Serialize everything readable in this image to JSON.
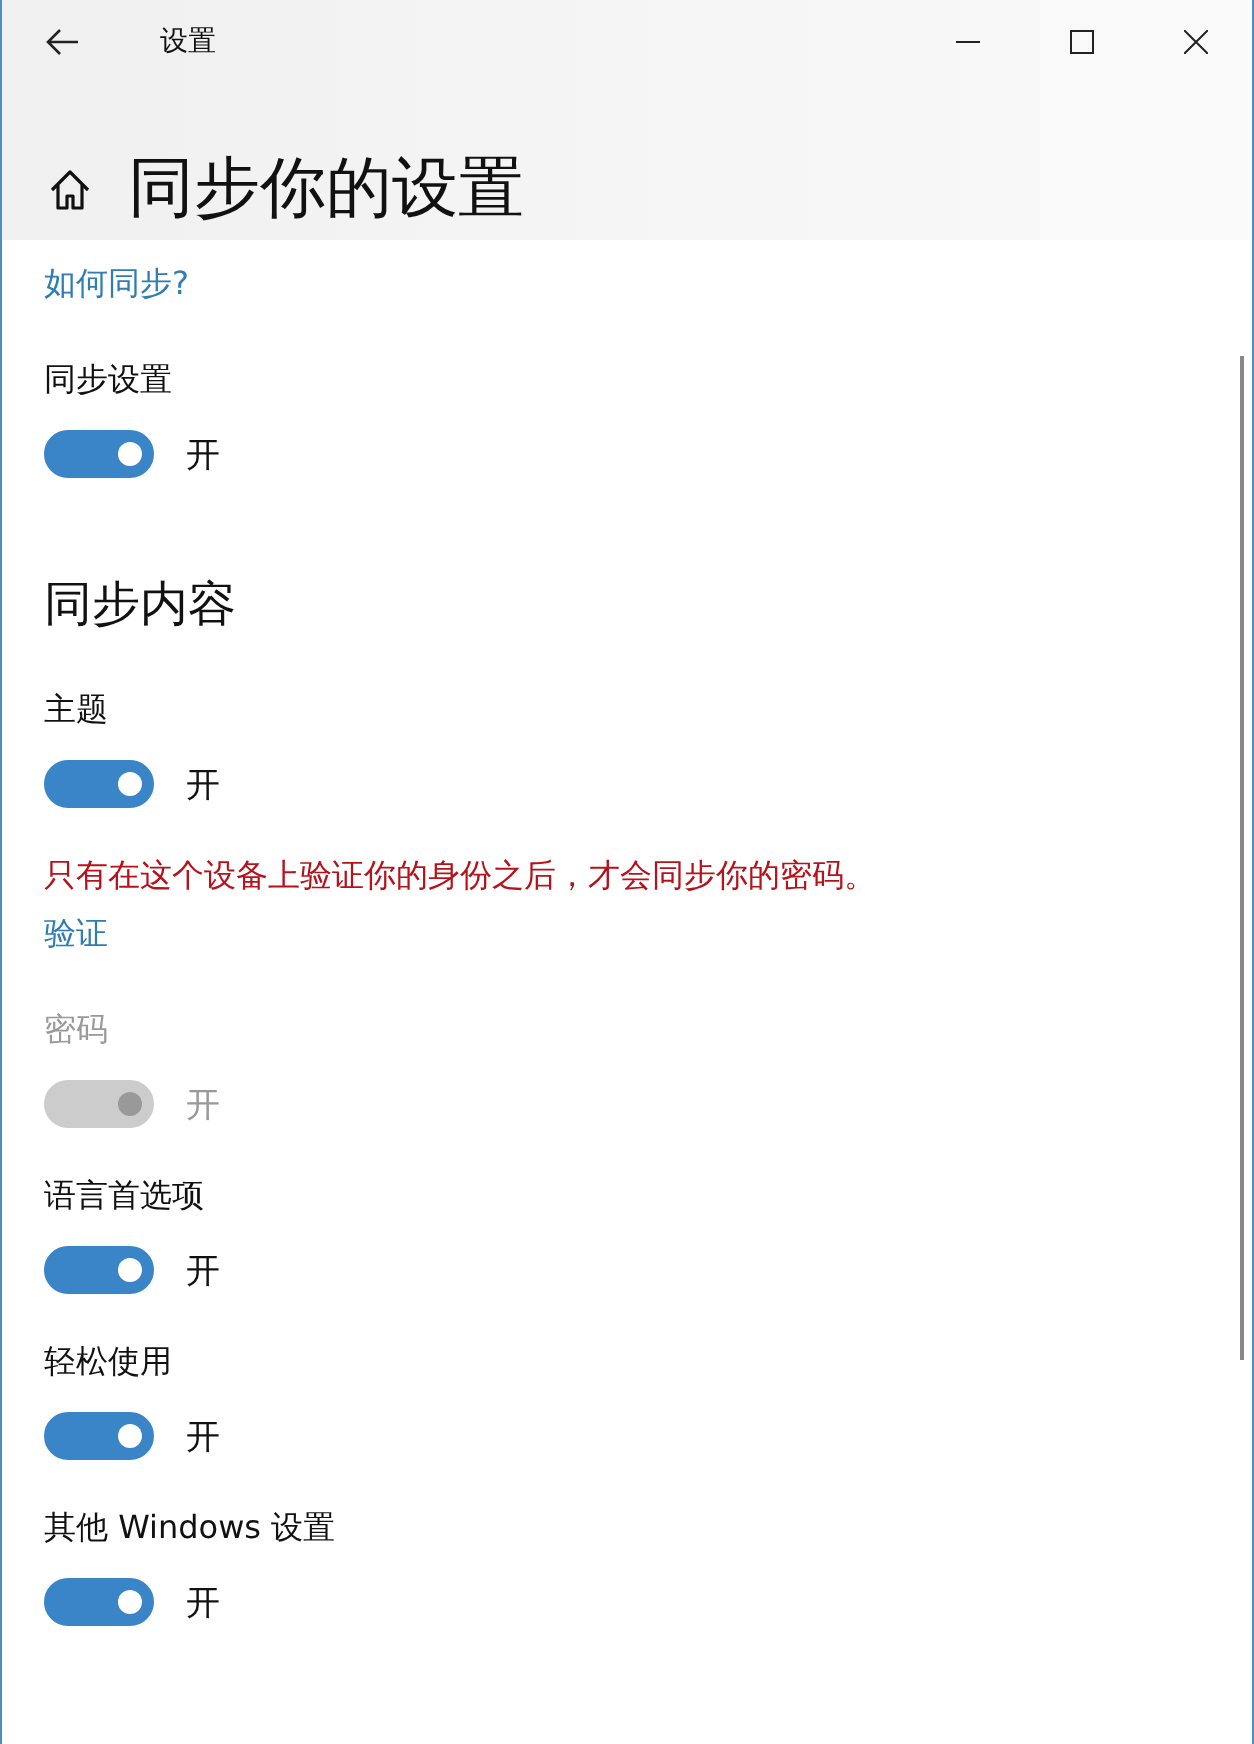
{
  "window": {
    "title": "设置"
  },
  "header": {
    "title": "同步你的设置"
  },
  "items": [
    {
      "kind": "link",
      "text": "如何同步?"
    },
    {
      "kind": "toggle",
      "label": "同步设置",
      "on": true,
      "disabled": false,
      "state_text": "开"
    },
    {
      "kind": "heading",
      "text": "同步内容"
    },
    {
      "kind": "toggle",
      "label": "主题",
      "on": true,
      "disabled": false,
      "state_text": "开"
    },
    {
      "kind": "warning",
      "text": "只有在这个设备上验证你的身份之后，才会同步你的密码。"
    },
    {
      "kind": "link",
      "text": "验证"
    },
    {
      "kind": "toggle",
      "label": "密码",
      "on": true,
      "disabled": true,
      "state_text": "开"
    },
    {
      "kind": "toggle",
      "label": "语言首选项",
      "on": true,
      "disabled": false,
      "state_text": "开"
    },
    {
      "kind": "toggle",
      "label": "轻松使用",
      "on": true,
      "disabled": false,
      "state_text": "开"
    },
    {
      "kind": "toggle",
      "label": "其他 Windows 设置",
      "on": true,
      "disabled": false,
      "state_text": "开"
    }
  ]
}
